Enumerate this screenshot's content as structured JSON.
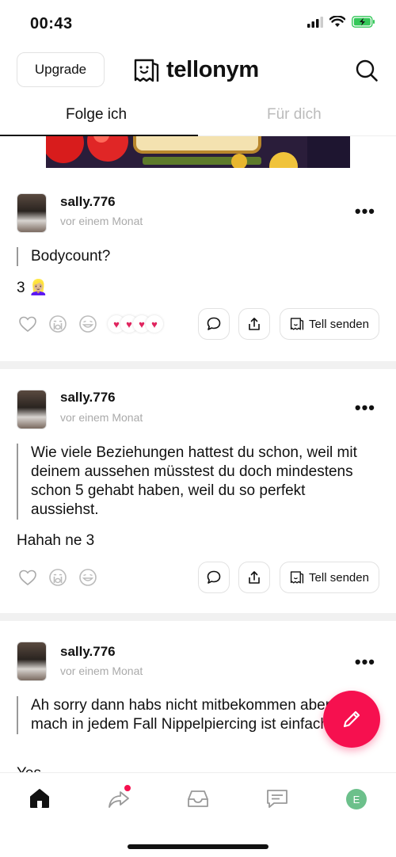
{
  "status_bar": {
    "time": "00:43"
  },
  "header": {
    "upgrade_label": "Upgrade",
    "logo_text": "tellonym"
  },
  "tabs": {
    "following": "Folge ich",
    "for_you": "Für dich"
  },
  "colors": {
    "accent": "#f6104f",
    "profile": "#6cc08b",
    "battery": "#34c759"
  },
  "posts": [
    {
      "username": "sally.776",
      "timestamp": "vor einem Monat",
      "question": "Bodycount?",
      "answer": "3 👱🏼‍♀️",
      "hearts": [
        "♥",
        "♥",
        "♥",
        "♥"
      ],
      "tell_label": "Tell senden"
    },
    {
      "username": "sally.776",
      "timestamp": "vor einem Monat",
      "question": "Wie viele Beziehungen hattest du schon, weil mit deinem aussehen müsstest du doch mindestens schon 5 gehabt haben, weil du so perfekt aussiehst.",
      "answer": "Hahah ne 3",
      "tell_label": "Tell senden"
    },
    {
      "username": "sally.776",
      "timestamp": "vor einem Monat",
      "question": "Ah sorry dann habs nicht mitbekommen aber mach in jedem Fall Nippelpiercing ist einfach geil",
      "answer": "Yes"
    }
  ],
  "tabbar": {
    "profile_initial": "E",
    "icons": [
      "home-icon",
      "share-arrow-icon",
      "inbox-icon",
      "messages-icon",
      "profile-avatar"
    ]
  }
}
